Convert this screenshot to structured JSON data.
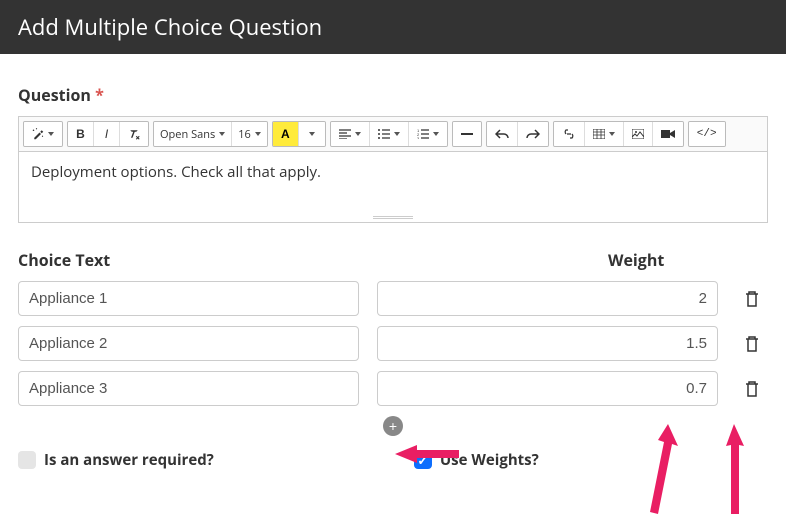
{
  "header": {
    "title": "Add Multiple Choice Question"
  },
  "question": {
    "label": "Question",
    "required_mark": "*",
    "body": "Deployment options.  Check all that apply."
  },
  "toolbar": {
    "font_family": "Open Sans",
    "font_size": "16"
  },
  "columns": {
    "choice": "Choice Text",
    "weight": "Weight"
  },
  "choices": [
    {
      "text": "Appliance 1",
      "weight": "2"
    },
    {
      "text": "Appliance 2",
      "weight": "1.5"
    },
    {
      "text": "Appliance 3",
      "weight": "0.7"
    }
  ],
  "options": {
    "required": {
      "label": "Is an answer required?",
      "checked": false
    },
    "use_weights": {
      "label": "Use Weights?",
      "checked": true
    }
  }
}
